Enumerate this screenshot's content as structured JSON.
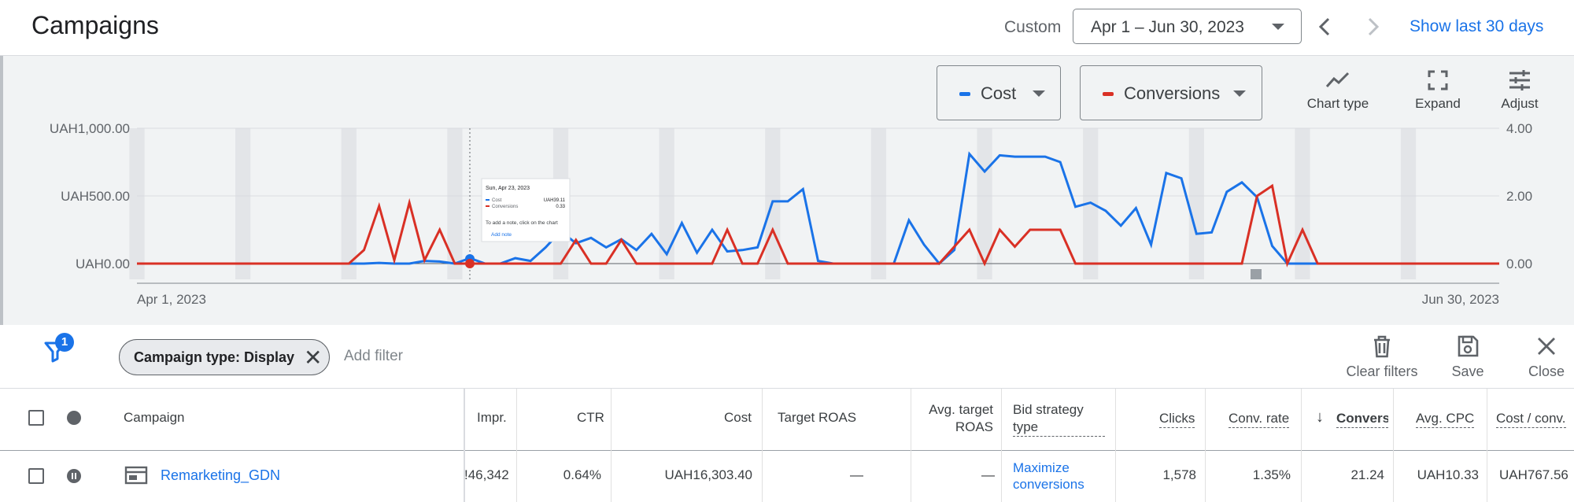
{
  "header": {
    "title": "Campaigns",
    "date_range_label": "Custom",
    "date_range_value": "Apr 1 – Jun 30, 2023",
    "show_last": "Show last 30 days"
  },
  "chart_controls": {
    "metric1": {
      "label": "Cost",
      "color": "#1a73e8"
    },
    "metric2": {
      "label": "Conversions",
      "color": "#d93025"
    },
    "tools": {
      "chart_type": "Chart type",
      "expand": "Expand",
      "adjust": "Adjust"
    }
  },
  "chart_data": {
    "type": "line",
    "x_start_label": "Apr 1, 2023",
    "x_end_label": "Jun 30, 2023",
    "y_left_ticks": [
      "UAH1,000.00",
      "UAH500.00",
      "UAH0.00"
    ],
    "y_right_ticks": [
      "4.00",
      "2.00",
      "0.00"
    ],
    "ylim_left": [
      0,
      1000
    ],
    "ylim_right": [
      0,
      4
    ],
    "series": [
      {
        "name": "Cost",
        "color": "#1a73e8",
        "axis": "left",
        "values": [
          0,
          0,
          0,
          0,
          0,
          0,
          0,
          0,
          0,
          0,
          0,
          0,
          0,
          0,
          0,
          0,
          5,
          0,
          0,
          20,
          15,
          0,
          40,
          0,
          0,
          40,
          20,
          120,
          240,
          150,
          190,
          120,
          180,
          100,
          220,
          70,
          300,
          80,
          250,
          90,
          100,
          120,
          460,
          460,
          550,
          20,
          0,
          0,
          0,
          0,
          0,
          320,
          140,
          0,
          100,
          810,
          680,
          800,
          790,
          790,
          790,
          750,
          420,
          450,
          390,
          280,
          410,
          140,
          670,
          630,
          220,
          230,
          530,
          600,
          490,
          130,
          0,
          0,
          0,
          0,
          0,
          0,
          0,
          0,
          0,
          0,
          0,
          0,
          0,
          0,
          0
        ]
      },
      {
        "name": "Conversions",
        "color": "#d93025",
        "axis": "right",
        "values": [
          0,
          0,
          0,
          0,
          0,
          0,
          0,
          0,
          0,
          0,
          0,
          0,
          0,
          0,
          0,
          0.4,
          1.7,
          0.1,
          1.8,
          0.1,
          1,
          0,
          0,
          0,
          0,
          0,
          0,
          0,
          0,
          0.7,
          0,
          0,
          0.7,
          0,
          0,
          0,
          0,
          0,
          0,
          1,
          0,
          0,
          1,
          0,
          0,
          0,
          0,
          0,
          0,
          0,
          0,
          0,
          0,
          0,
          0.5,
          1,
          0,
          1,
          0.5,
          1,
          1,
          1,
          0,
          0,
          0,
          0,
          0,
          0,
          0,
          0,
          0,
          0,
          0,
          0,
          2,
          2.3,
          0,
          1,
          0,
          0,
          0,
          0,
          0,
          0,
          0,
          0,
          0,
          0,
          0,
          0,
          0
        ]
      }
    ]
  },
  "tooltip": {
    "date": "Sun, Apr 23, 2023",
    "cost_label": "Cost",
    "cost_value": "UAH39.11",
    "conv_label": "Conversions",
    "conv_value": "0.33",
    "note": "To add a note, click on the chart",
    "link": "Add note"
  },
  "filter_bar": {
    "badge": "1",
    "chip": "Campaign type: Display",
    "add_filter": "Add filter",
    "clear_filters": "Clear filters",
    "save": "Save",
    "close": "Close"
  },
  "table": {
    "headers": {
      "campaign": "Campaign",
      "impr": "Impr.",
      "ctr": "CTR",
      "cost": "Cost",
      "target_roas": "Target ROAS",
      "avg_target_roas_1": "Avg. target",
      "avg_target_roas_2": "ROAS",
      "bid_strategy_1": "Bid strategy",
      "bid_strategy_2": "type",
      "clicks": "Clicks",
      "conv_rate": "Conv. rate",
      "conversions": "Convers",
      "avg_cpc": "Avg. CPC",
      "cost_conv": "Cost / conv."
    },
    "row": {
      "campaign": "Remarketing_GDN",
      "impr": "!46,342",
      "ctr": "0.64%",
      "cost": "UAH16,303.40",
      "target_roas": "—",
      "avg_target_roas": "—",
      "bid_strategy_1": "Maximize",
      "bid_strategy_2": "conversions",
      "clicks": "1,578",
      "conv_rate": "1.35%",
      "conversions": "21.24",
      "avg_cpc": "UAH10.33",
      "cost_conv": "UAH767.56"
    }
  }
}
